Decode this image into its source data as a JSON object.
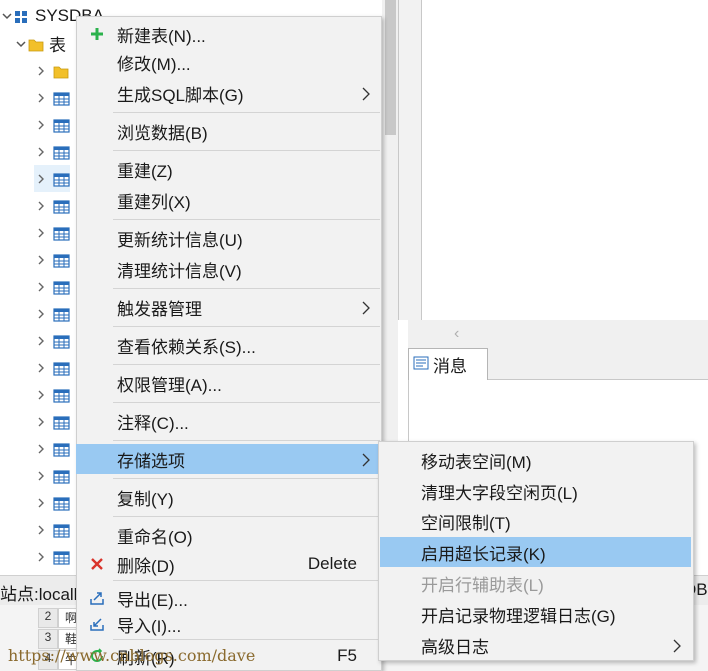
{
  "tree": {
    "root_label": "SYSDBA",
    "folder_label": "表",
    "row_count": 19
  },
  "message_panel": {
    "tab_label": "消息"
  },
  "status": {
    "left_text": "站点:localh",
    "right_text": "DB"
  },
  "grid": {
    "rows": [
      {
        "num": "2",
        "cell": "啊"
      },
      {
        "num": "3",
        "cell": "鞋"
      },
      {
        "num": "4",
        "cell": "牛"
      }
    ]
  },
  "watermark": "https://www.cnblogs.com/dave",
  "context_menu": {
    "items": [
      {
        "label": "新建表(N)...",
        "icon": "plus-icon"
      },
      {
        "label": "修改(M)..."
      },
      {
        "label": "生成SQL脚本(G)",
        "submenu": true
      },
      {
        "label": "浏览数据(B)"
      },
      {
        "label": "重建(Z)"
      },
      {
        "label": "重建列(X)"
      },
      {
        "label": "更新统计信息(U)"
      },
      {
        "label": "清理统计信息(V)"
      },
      {
        "label": "触发器管理",
        "submenu": true
      },
      {
        "label": "查看依赖关系(S)..."
      },
      {
        "label": "权限管理(A)..."
      },
      {
        "label": "注释(C)..."
      },
      {
        "label": "存储选项",
        "submenu": true,
        "highlighted": true
      },
      {
        "label": "复制(Y)"
      },
      {
        "label": "重命名(O)"
      },
      {
        "label": "删除(D)",
        "shortcut": "Delete",
        "icon": "delete-x-icon"
      },
      {
        "label": "导出(E)...",
        "icon": "export-icon"
      },
      {
        "label": "导入(I)...",
        "icon": "import-icon"
      },
      {
        "label": "刷新(R)",
        "shortcut": "F5",
        "icon": "refresh-icon"
      }
    ]
  },
  "submenu": {
    "items": [
      {
        "label": "移动表空间(M)"
      },
      {
        "label": "清理大字段空闲页(L)"
      },
      {
        "label": "空间限制(T)"
      },
      {
        "label": "启用超长记录(K)",
        "highlighted": true
      },
      {
        "label": "开启行辅助表(L)",
        "disabled": true
      },
      {
        "label": "开启记录物理逻辑日志(G)"
      },
      {
        "label": "高级日志",
        "submenu": true
      }
    ]
  },
  "colors": {
    "highlight": "#99c9f2",
    "menu_bg": "#f2f2f2",
    "plus_green": "#2bb24c",
    "delete_red": "#d9342b",
    "icon_blue": "#2a6ebb",
    "folder_yellow": "#f2c02a"
  }
}
